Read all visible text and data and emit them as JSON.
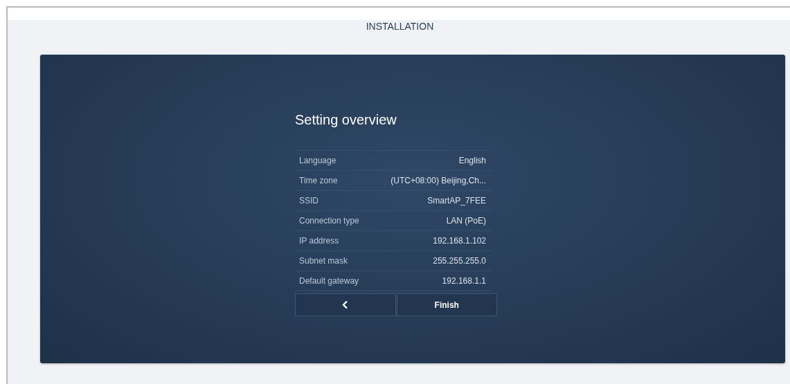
{
  "header": {
    "title": "INSTALLATION"
  },
  "panel": {
    "title": "Setting overview"
  },
  "settings": [
    {
      "label": "Language",
      "value": "English"
    },
    {
      "label": "Time zone",
      "value": "(UTC+08:00) Beijing,Ch..."
    },
    {
      "label": "SSID",
      "value": "SmartAP_7FEE"
    },
    {
      "label": "Connection type",
      "value": "LAN (PoE)"
    },
    {
      "label": "IP address",
      "value": "192.168.1.102"
    },
    {
      "label": "Subnet mask",
      "value": "255.255.255.0"
    },
    {
      "label": "Default gateway",
      "value": "192.168.1.1"
    }
  ],
  "buttons": {
    "finish": "Finish"
  }
}
